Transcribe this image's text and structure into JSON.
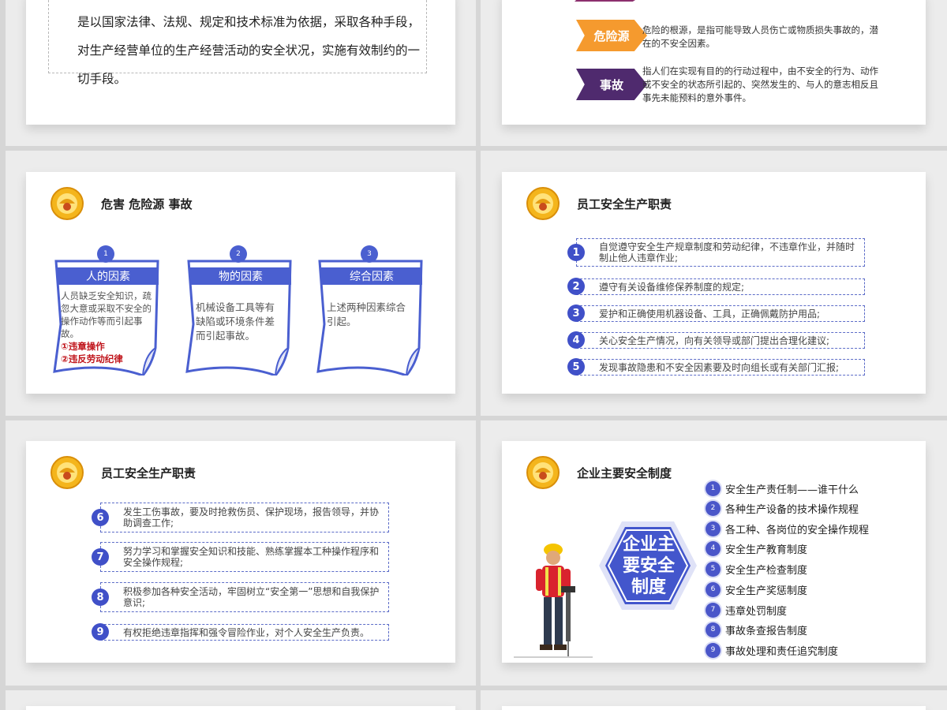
{
  "panel_top_left": {
    "lines": [
      "是以国家法律、法规、规定和技术标准为依据，采取各种手段，",
      "对生产经营单位的生产经营活动的安全状况，实施有效制约的一",
      "切手段。"
    ]
  },
  "panel_top_right": {
    "items": [
      {
        "tag": "危险源",
        "color": "#f59a2e",
        "text": "危险的根源，是指可能导致人员伤亡或物质损失事故的，潜在的不安全因素。"
      },
      {
        "tag": "事故",
        "color": "#4f2a6e",
        "text": "指人们在实现有目的的行动过程中，由不安全的行为、动作或不安全的状态所引起的、突然发生的、与人的意志相反且事先未能预料的意外事件。"
      }
    ]
  },
  "panel_factors": {
    "title": "危害 危险源 事故",
    "notes": [
      {
        "num": "1",
        "head": "人的因素",
        "body": "人员缺乏安全知识，疏忽大意或采取不安全的操作动作等而引起事故。",
        "red": [
          "①违章操作",
          "②违反劳动纪律"
        ]
      },
      {
        "num": "2",
        "head": "物的因素",
        "body": "机械设备工具等有缺陷或环境条件差而引起事故。",
        "red": []
      },
      {
        "num": "3",
        "head": "综合因素",
        "body": "上述两种因素综合引起。",
        "red": []
      }
    ]
  },
  "panel_duties_1": {
    "title": "员工安全生产职责",
    "items": [
      {
        "num": "1",
        "text": "自觉遵守安全生产规章制度和劳动纪律，不违章作业，并随时制止他人违章作业;"
      },
      {
        "num": "2",
        "text": "遵守有关设备维修保养制度的规定;"
      },
      {
        "num": "3",
        "text": "爱护和正确使用机器设备、工具，正确佩戴防护用品;"
      },
      {
        "num": "4",
        "text": "关心安全生产情况，向有关领导或部门提出合理化建议;"
      },
      {
        "num": "5",
        "text": "发现事故隐患和不安全因素要及时向组长或有关部门汇报;"
      }
    ]
  },
  "panel_duties_2": {
    "title": "员工安全生产职责",
    "items": [
      {
        "num": "6",
        "text": "发生工伤事故，要及时抢救伤员、保护现场，报告领导，并协助调查工作;"
      },
      {
        "num": "7",
        "text": "努力学习和掌握安全知识和技能、熟练掌握本工种操作程序和安全操作规程;"
      },
      {
        "num": "8",
        "text": "积极参加各种安全活动，牢固树立“安全第一”思想和自我保护意识;"
      },
      {
        "num": "9",
        "text": "有权拒绝违章指挥和强令冒险作业，对个人安全生产负责。"
      }
    ]
  },
  "panel_systems": {
    "title": "企业主要安全制度",
    "hex_lines": [
      "企业主",
      "要安全",
      "制度"
    ],
    "items": [
      {
        "num": "1",
        "text": "安全生产责任制——谁干什么"
      },
      {
        "num": "2",
        "text": "各种生产设备的技术操作规程"
      },
      {
        "num": "3",
        "text": "各工种、各岗位的安全操作规程"
      },
      {
        "num": "4",
        "text": "安全生产教育制度"
      },
      {
        "num": "5",
        "text": "安全生产检查制度"
      },
      {
        "num": "6",
        "text": "安全生产奖惩制度"
      },
      {
        "num": "7",
        "text": "违章处罚制度"
      },
      {
        "num": "8",
        "text": "事故条查报告制度"
      },
      {
        "num": "9",
        "text": "事故处理和责任追究制度"
      }
    ]
  },
  "colors": {
    "accent_blue": "#4050c8",
    "note_blue": "#4a5fd0",
    "warning_red": "#c0141b",
    "orange": "#f59a2e",
    "purple": "#4f2a6e"
  },
  "icons": [
    "safety-logo-icon",
    "construction-worker-icon"
  ]
}
